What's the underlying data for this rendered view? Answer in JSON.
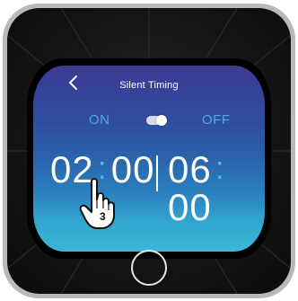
{
  "screen": {
    "title": "Silent Timing",
    "back_icon": "chevron-left-icon",
    "toggle": {
      "on_label": "ON",
      "off_label": "OFF",
      "state": "on"
    },
    "start_time": {
      "hour": "02",
      "separator": ":",
      "minute": "00"
    },
    "end_time": {
      "hour": "06",
      "separator": ":",
      "minute": "00"
    }
  },
  "callout": {
    "icon": "pointing-hand-icon",
    "step_number": "3"
  },
  "colors": {
    "screen_top": "#3c3a93",
    "screen_bottom": "#3ab7d6",
    "accent_blue": "#52a6e6",
    "device_frame": "#b9b9bb",
    "device_body": "#151516"
  }
}
